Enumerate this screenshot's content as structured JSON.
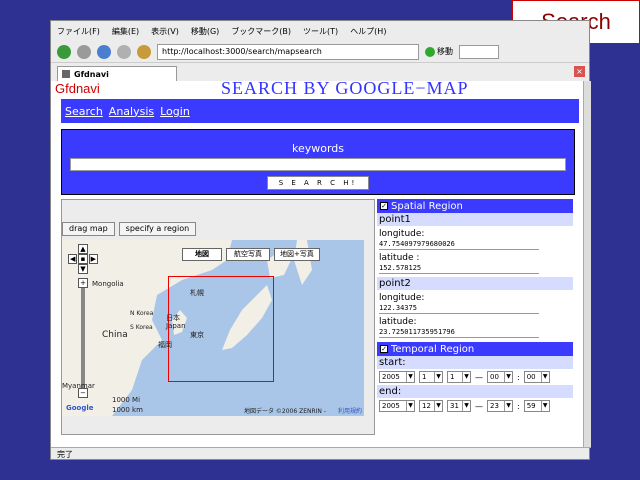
{
  "slide": {
    "title": "Search"
  },
  "browser": {
    "menu": [
      "ファイル(F)",
      "編集(E)",
      "表示(V)",
      "移動(G)",
      "ブックマーク(B)",
      "ツール(T)",
      "ヘルプ(H)"
    ],
    "url": "http://localhost:3000/search/mapsearch",
    "go_label": "移動",
    "tab_title": "Gfdnavi",
    "status": "完了"
  },
  "page": {
    "logo": "Gfdnavi",
    "title": "SEARCH  BY  GOOGLE−MAP",
    "nav": [
      "Search",
      "Analysis",
      "Login"
    ],
    "keywords_label": "keywords",
    "search_button": "S E A R C H!"
  },
  "map": {
    "drag_btn": "drag map",
    "region_btn": "specify a region",
    "type_buttons": [
      "地図",
      "航空写真",
      "地図+写真"
    ],
    "labels": {
      "mongolia": "Mongolia",
      "china": "China",
      "nkorea": "N Korea",
      "skorea": "S Korea",
      "japan": "日本\nJapan",
      "sapporo": "札幌",
      "tokyo": "東京",
      "fukuoka": "福岡",
      "myanmar": "Myanmar",
      "scale1": "1000 Mi",
      "scale2": "1000 km",
      "copyright": "地図データ ©2006 ZENRIN -",
      "terms": "利用規約",
      "google": "Google"
    }
  },
  "spatial": {
    "header": "Spatial Region",
    "point1": "point1",
    "point2": "point2",
    "lon_label": "longitude:",
    "lat_label1": "latitude  :",
    "lat_label2": "latitude:",
    "p1_lon": "47.754097979680026",
    "p1_lat": "152.578125",
    "p2_lon": "122.34375",
    "p2_lat": "23.725011735951796"
  },
  "temporal": {
    "header": "Temporal Region",
    "start": "start:",
    "end": "end:",
    "start_vals": [
      "2005",
      "1",
      "1",
      "00",
      "00"
    ],
    "end_vals": [
      "2005",
      "12",
      "31",
      "23",
      "59"
    ],
    "dash": "—",
    "colon": ":"
  }
}
